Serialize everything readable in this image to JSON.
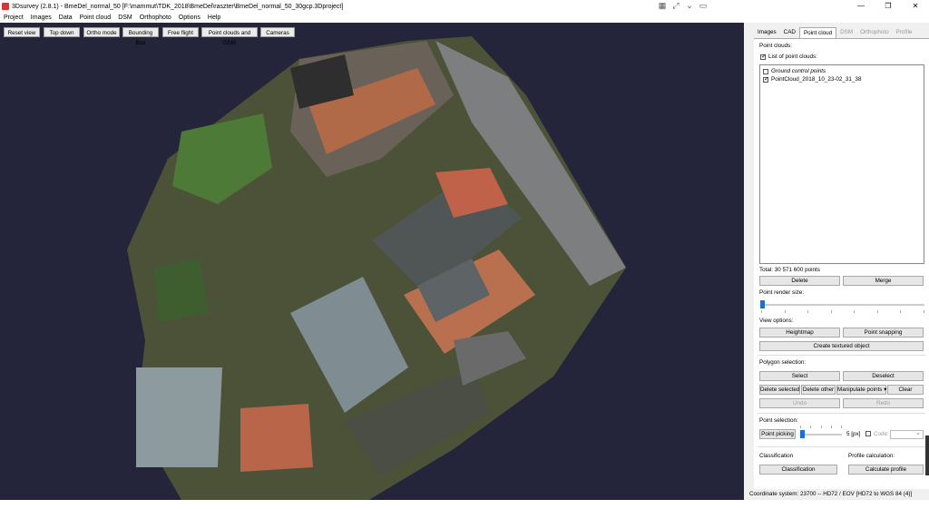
{
  "window": {
    "title": "3Dsurvey (2.8.1) - BmeDel_normal_50 [F:\\mammut\\TDK_2018\\BmeDel\\raszter\\BmeDel_normal_50_30gcp.3Dproject]",
    "toolbar_icons": [
      "grid-icon",
      "fullscreen-icon",
      "chevron-down-icon",
      "monitor-icon"
    ],
    "controls": {
      "minimize": "—",
      "restore": "❐",
      "close": "✕"
    }
  },
  "menu": [
    "Project",
    "Images",
    "Data",
    "Point cloud",
    "DSM",
    "Orthophoto",
    "Options",
    "Help"
  ],
  "viewport": {
    "buttons": [
      "Reset view",
      "Top down",
      "Ortho mode",
      "Bounding Box",
      "Free flight",
      "Point clouds and DSM",
      "Cameras"
    ]
  },
  "tabs": [
    {
      "label": "Images",
      "state": "normal"
    },
    {
      "label": "CAD",
      "state": "normal"
    },
    {
      "label": "Point cloud",
      "state": "active"
    },
    {
      "label": "DSM",
      "state": "disabled"
    },
    {
      "label": "Orthophoto",
      "state": "disabled"
    },
    {
      "label": "Profile",
      "state": "disabled"
    }
  ],
  "panel": {
    "point_clouds_header": "Point clouds:",
    "list_checkbox_label": "List of point clouds:",
    "items": [
      {
        "label": "Ground control points",
        "checked": false
      },
      {
        "label": "PointCloud_2018_10_23-02_31_38",
        "checked": true
      }
    ],
    "total": "Total: 30 571 600 points",
    "delete": "Delete",
    "merge": "Merge",
    "render_size_label": "Point render size:",
    "view_options_label": "View options:",
    "heightmap": "Heightmap",
    "point_snapping": "Point snapping",
    "create_textured": "Create textured object",
    "polygon_label": "Polygon selection:",
    "select": "Select",
    "deselect": "Deselect",
    "delete_selected": "Delete selected",
    "delete_other": "Delete other",
    "manipulate": "Manipulate points",
    "clear": "Clear",
    "undo": "Undo",
    "redo": "Redo",
    "point_selection_label": "Point selection:",
    "point_picking": "Point picking",
    "px_value": "5 [px]",
    "code_label": "Code:",
    "classification_label": "Classification",
    "classification_button": "Classification",
    "profile_label": "Profile calculation:",
    "profile_button": "Calculate profile"
  },
  "status": "Coordinate system: 23700 -- HD72 / EOV [HD72 to WGS 84 (4)]"
}
